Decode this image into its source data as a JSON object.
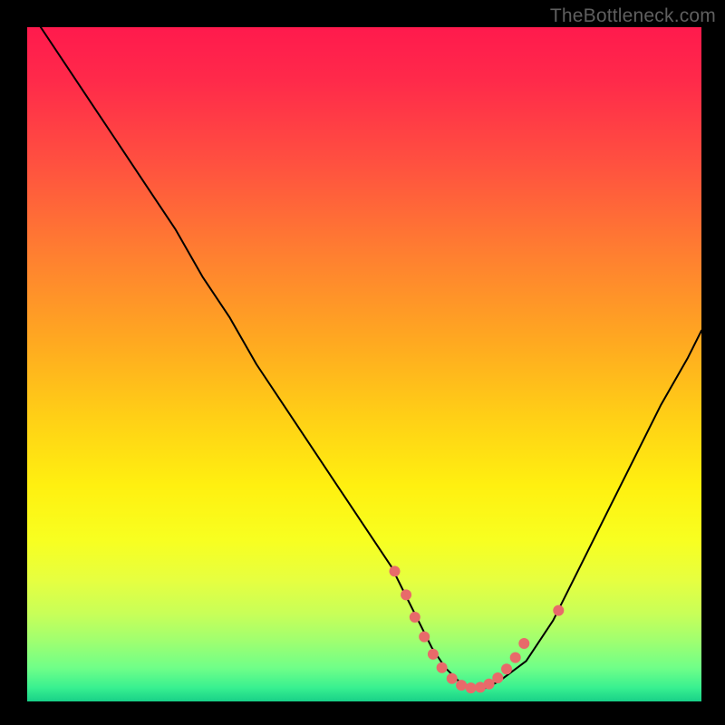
{
  "watermark": "TheBottleneck.com",
  "chart_data": {
    "type": "line",
    "title": "",
    "xlabel": "",
    "ylabel": "",
    "xlim": [
      0,
      100
    ],
    "ylim": [
      0,
      100
    ],
    "grid": false,
    "series": [
      {
        "name": "bottleneck-curve",
        "color": "#000000",
        "x": [
          2,
          6,
          10,
          14,
          18,
          22,
          26,
          30,
          34,
          38,
          42,
          46,
          50,
          54,
          56,
          58,
          60,
          62,
          64,
          66,
          68,
          70,
          74,
          78,
          82,
          86,
          90,
          94,
          98,
          100
        ],
        "y": [
          100,
          94,
          88,
          82,
          76,
          70,
          63,
          57,
          50,
          44,
          38,
          32,
          26,
          20,
          16,
          12,
          8,
          5,
          3,
          2,
          2,
          3,
          6,
          12,
          20,
          28,
          36,
          44,
          51,
          55
        ]
      }
    ],
    "markers": {
      "name": "highlighted-points",
      "color": "#e86a6a",
      "radius_px": 6,
      "x": [
        54.5,
        56.2,
        57.5,
        58.9,
        60.2,
        61.5,
        63.0,
        64.4,
        65.8,
        67.2,
        68.5,
        69.8,
        71.1,
        72.4,
        73.7,
        78.8
      ],
      "y": [
        19.3,
        15.8,
        12.5,
        9.6,
        7.0,
        5.0,
        3.4,
        2.4,
        2.0,
        2.1,
        2.6,
        3.5,
        4.8,
        6.5,
        8.6,
        13.5
      ]
    }
  }
}
